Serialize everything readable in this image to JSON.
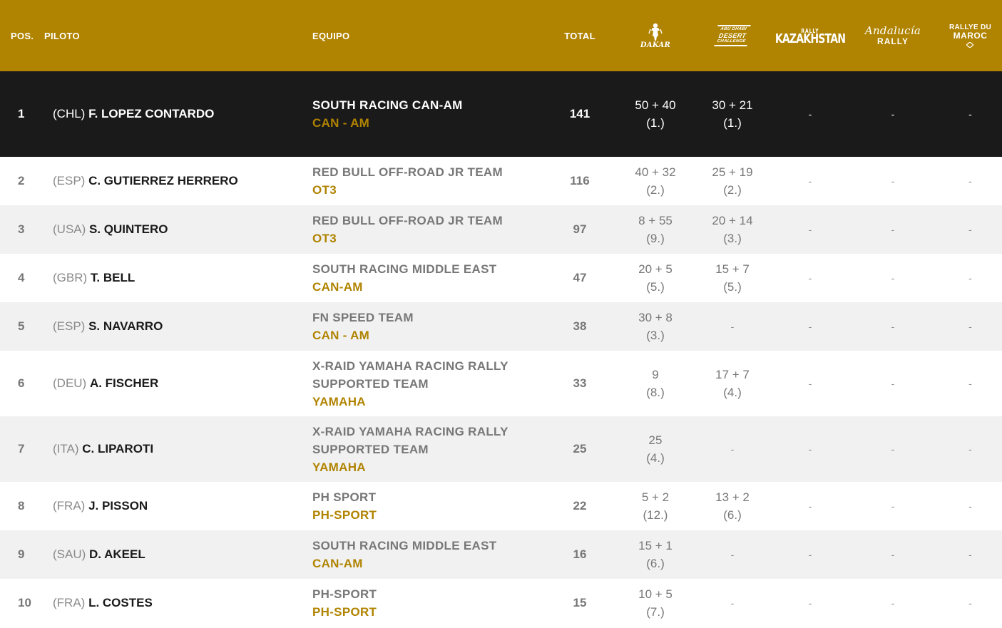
{
  "colors": {
    "header_bg": "#b08300",
    "accent": "#b08300",
    "highlight_row_bg": "#1a1a1a",
    "alt_row_bg": "#f1f1f1"
  },
  "header": {
    "pos": "POS.",
    "piloto": "PILOTO",
    "equipo": "EQUIPO",
    "total": "TOTAL",
    "rally_logos": [
      {
        "icon": "dakar-logo",
        "text": "DAKAR"
      },
      {
        "icon": "abu-dhabi-desert-challenge-logo",
        "line1": "ABU DHABI",
        "line2": "DESERT",
        "line3": "CHALLENGE"
      },
      {
        "icon": "rally-kazakhstan-logo",
        "line1": "RALLY",
        "line2": "KAZAKHSTAN"
      },
      {
        "icon": "andalucia-rally-logo",
        "line1": "Andalucía",
        "line2": "RALLY"
      },
      {
        "icon": "rallye-du-maroc-logo",
        "line1": "RALLYE DU",
        "line2": "MAROC"
      }
    ]
  },
  "rows": [
    {
      "pos": "1",
      "nat": "(CHL)",
      "name": "F. LOPEZ CONTARDO",
      "team": "SOUTH RACING CAN-AM",
      "brand": "CAN - AM",
      "total": "141",
      "r1_pts": "50 + 40",
      "r1_rank": "(1.)",
      "r2_pts": "30 + 21",
      "r2_rank": "(1.)",
      "r3": "-",
      "r4": "-",
      "r5": "-"
    },
    {
      "pos": "2",
      "nat": "(ESP)",
      "name": "C. GUTIERREZ HERRERO",
      "team": "RED BULL OFF-ROAD JR TEAM",
      "brand": "OT3",
      "total": "116",
      "r1_pts": "40 + 32",
      "r1_rank": "(2.)",
      "r2_pts": "25 + 19",
      "r2_rank": "(2.)",
      "r3": "-",
      "r4": "-",
      "r5": "-"
    },
    {
      "pos": "3",
      "nat": "(USA)",
      "name": "S. QUINTERO",
      "team": "RED BULL OFF-ROAD JR TEAM",
      "brand": "OT3",
      "total": "97",
      "r1_pts": "8 + 55",
      "r1_rank": "(9.)",
      "r2_pts": "20 + 14",
      "r2_rank": "(3.)",
      "r3": "-",
      "r4": "-",
      "r5": "-"
    },
    {
      "pos": "4",
      "nat": "(GBR)",
      "name": "T. BELL",
      "team": "SOUTH RACING MIDDLE EAST",
      "brand": "CAN-AM",
      "total": "47",
      "r1_pts": "20 + 5",
      "r1_rank": "(5.)",
      "r2_pts": "15 + 7",
      "r2_rank": "(5.)",
      "r3": "-",
      "r4": "-",
      "r5": "-"
    },
    {
      "pos": "5",
      "nat": "(ESP)",
      "name": "S. NAVARRO",
      "team": "FN SPEED TEAM",
      "brand": "CAN - AM",
      "total": "38",
      "r1_pts": "30 + 8",
      "r1_rank": "(3.)",
      "r2": "-",
      "r3": "-",
      "r4": "-",
      "r5": "-"
    },
    {
      "pos": "6",
      "nat": "(DEU)",
      "name": "A. FISCHER",
      "team": "X-RAID YAMAHA RACING RALLY SUPPORTED TEAM",
      "brand": "YAMAHA",
      "total": "33",
      "r1_pts": "9",
      "r1_rank": "(8.)",
      "r2_pts": "17 + 7",
      "r2_rank": "(4.)",
      "r3": "-",
      "r4": "-",
      "r5": "-"
    },
    {
      "pos": "7",
      "nat": "(ITA)",
      "name": "C. LIPAROTI",
      "team": "X-RAID YAMAHA RACING RALLY SUPPORTED TEAM",
      "brand": "YAMAHA",
      "total": "25",
      "r1_pts": "25",
      "r1_rank": "(4.)",
      "r2": "-",
      "r3": "-",
      "r4": "-",
      "r5": "-"
    },
    {
      "pos": "8",
      "nat": "(FRA)",
      "name": "J. PISSON",
      "team": "PH SPORT",
      "brand": "PH-SPORT",
      "total": "22",
      "r1_pts": "5 + 2",
      "r1_rank": "(12.)",
      "r2_pts": "13 + 2",
      "r2_rank": "(6.)",
      "r3": "-",
      "r4": "-",
      "r5": "-"
    },
    {
      "pos": "9",
      "nat": "(SAU)",
      "name": "D. AKEEL",
      "team": "SOUTH RACING MIDDLE EAST",
      "brand": "CAN-AM",
      "total": "16",
      "r1_pts": "15 + 1",
      "r1_rank": "(6.)",
      "r2": "-",
      "r3": "-",
      "r4": "-",
      "r5": "-"
    },
    {
      "pos": "10",
      "nat": "(FRA)",
      "name": "L. COSTES",
      "team": "PH-SPORT",
      "brand": "PH-SPORT",
      "total": "15",
      "r1_pts": "10 + 5",
      "r1_rank": "(7.)",
      "r2": "-",
      "r3": "-",
      "r4": "-",
      "r5": "-"
    }
  ]
}
